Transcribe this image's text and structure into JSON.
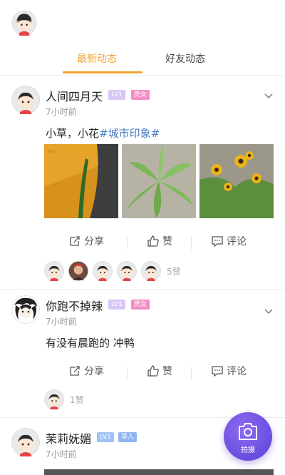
{
  "tabs": [
    {
      "label": "最新动态",
      "active": true
    },
    {
      "label": "好友动态",
      "active": false
    }
  ],
  "colors": {
    "accent": "#f0a530",
    "topic": "#4a7fc1",
    "fab": "#6a4ee0"
  },
  "posts": [
    {
      "name": "人间四月天",
      "level": "LV1",
      "role": "亮女",
      "time": "7小时前",
      "text": "小草，小花",
      "topic": "#城市印象#",
      "actions": {
        "share": "分享",
        "like": "赞",
        "comment": "评论"
      },
      "like_count": "5赞"
    },
    {
      "name": "你跑不掉辣",
      "level": "LV1",
      "role": "亮女",
      "time": "7小时前",
      "text": "有没有晨跑的 冲鸭",
      "actions": {
        "share": "分享",
        "like": "赞",
        "comment": "评论"
      },
      "like_count": "1赞"
    },
    {
      "name": "茉莉妩媚",
      "level": "LV1",
      "role": "草人",
      "time": "7小时前"
    }
  ],
  "fab": {
    "label": "拍摄",
    "icon": "camera-icon"
  }
}
